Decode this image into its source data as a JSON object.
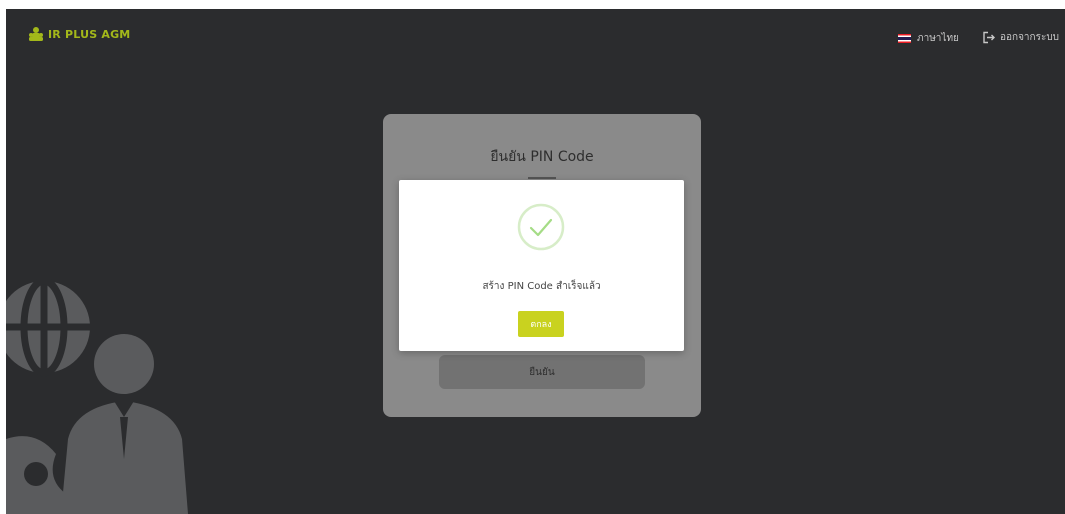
{
  "header": {
    "logo_text": "IR PLUS AGM",
    "language_label": "ภาษาไทย",
    "logout_label": "ออกจากระบบ"
  },
  "pin_card": {
    "title": "ยืนยัน PIN Code",
    "confirm_label": "ยืนยัน"
  },
  "dialog": {
    "message": "สร้าง PIN Code สำเร็จแล้ว",
    "ok_label": "ตกลง"
  },
  "colors": {
    "accent": "#c9d21f",
    "logo": "#a3b81a",
    "background": "#2b2c2e",
    "success": "#a5dc86"
  },
  "icons": {
    "logo": "people-group-icon",
    "language": "thai-flag-icon",
    "logout": "sign-out-icon",
    "success": "check-circle-icon"
  }
}
